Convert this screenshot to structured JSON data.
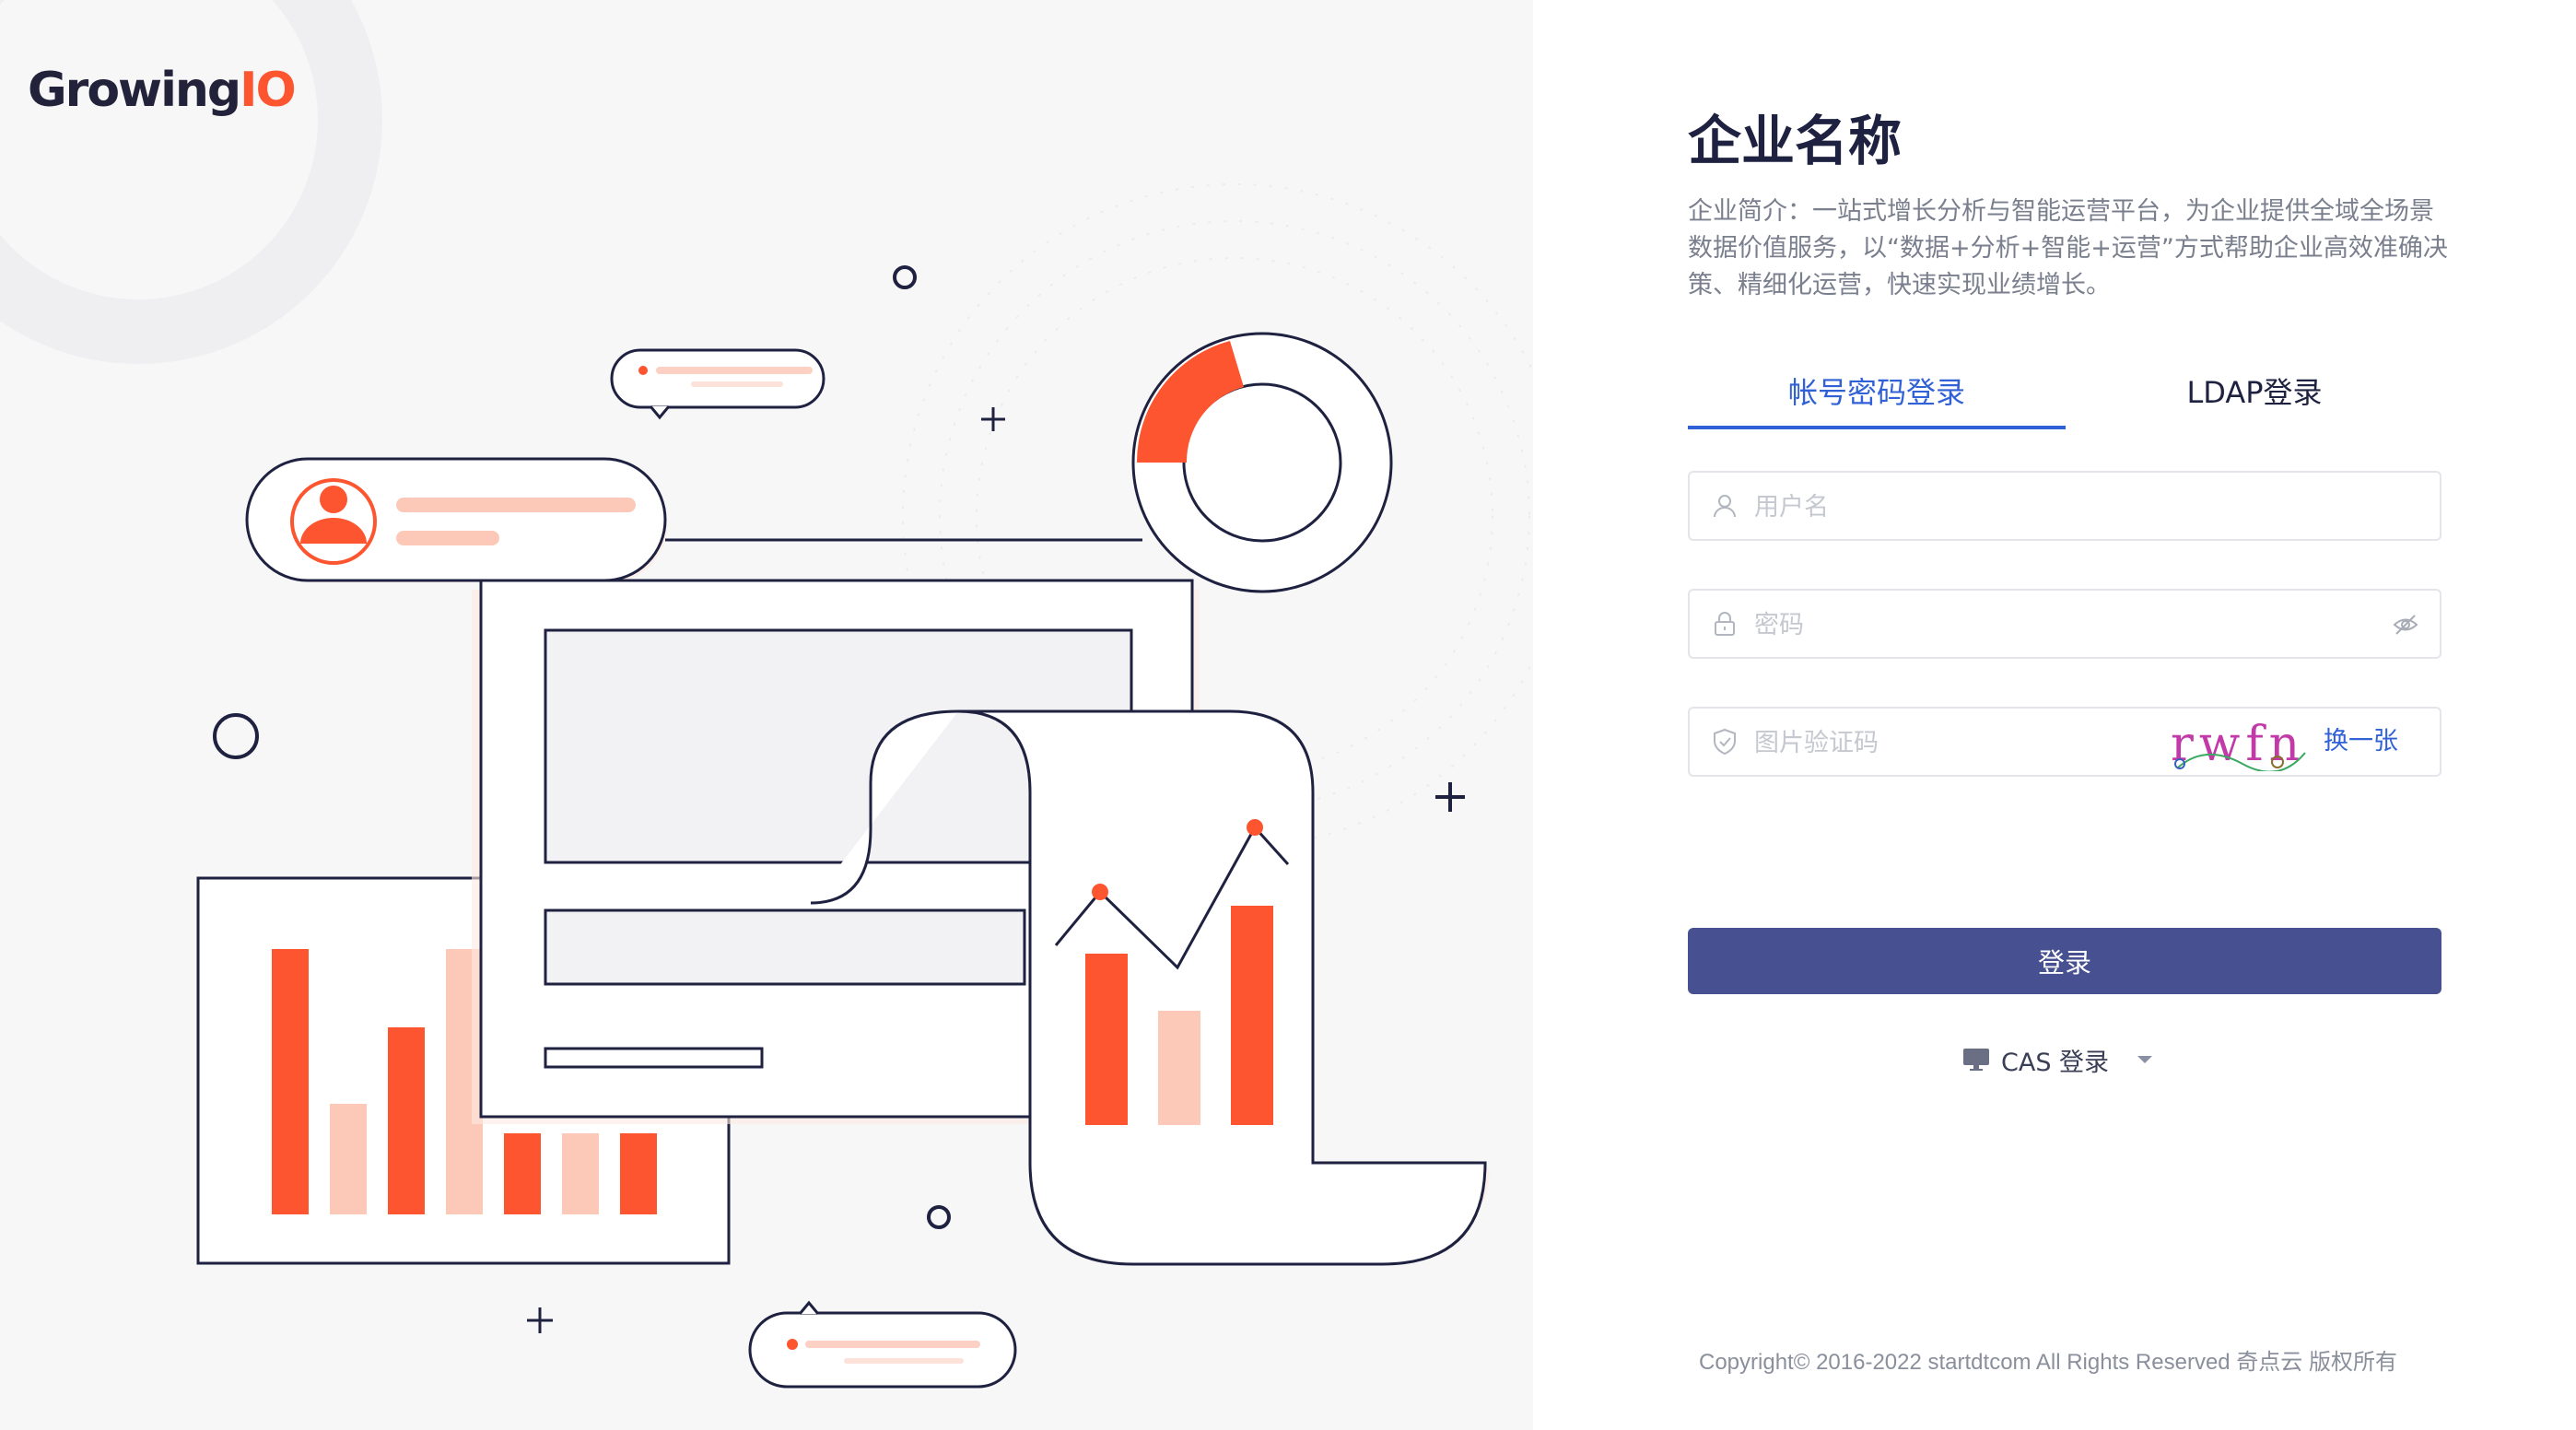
{
  "brand": {
    "logo_main": "Growing",
    "logo_accent": "IO"
  },
  "company": {
    "title": "企业名称",
    "description": "企业简介：一站式增长分析与智能运营平台，为企业提供全域全场景数据价值服务，以“数据+分析+智能+运营”方式帮助企业高效准确决策、精细化运营，快速实现业绩增长。"
  },
  "tabs": [
    {
      "label": "帐号密码登录",
      "active": true
    },
    {
      "label": "LDAP登录",
      "active": false
    }
  ],
  "form": {
    "username_placeholder": "用户名",
    "password_placeholder": "密码",
    "captcha_placeholder": "图片验证码",
    "captcha_text": "rwfn",
    "refresh_captcha_label": "换一张",
    "login_label": "登录"
  },
  "cas": {
    "label": "CAS 登录"
  },
  "footer": {
    "copyright": "Copyright© 2016-2022 startdtcom All Rights Reserved 奇点云 版权所有"
  },
  "colors": {
    "accent": "#fc5530",
    "primary": "#3061d6",
    "button": "#475191",
    "title": "#1e2240"
  },
  "icons": [
    "user-icon",
    "lock-icon",
    "eye-off-icon",
    "shield-icon",
    "monitor-icon",
    "caret-down-icon"
  ]
}
